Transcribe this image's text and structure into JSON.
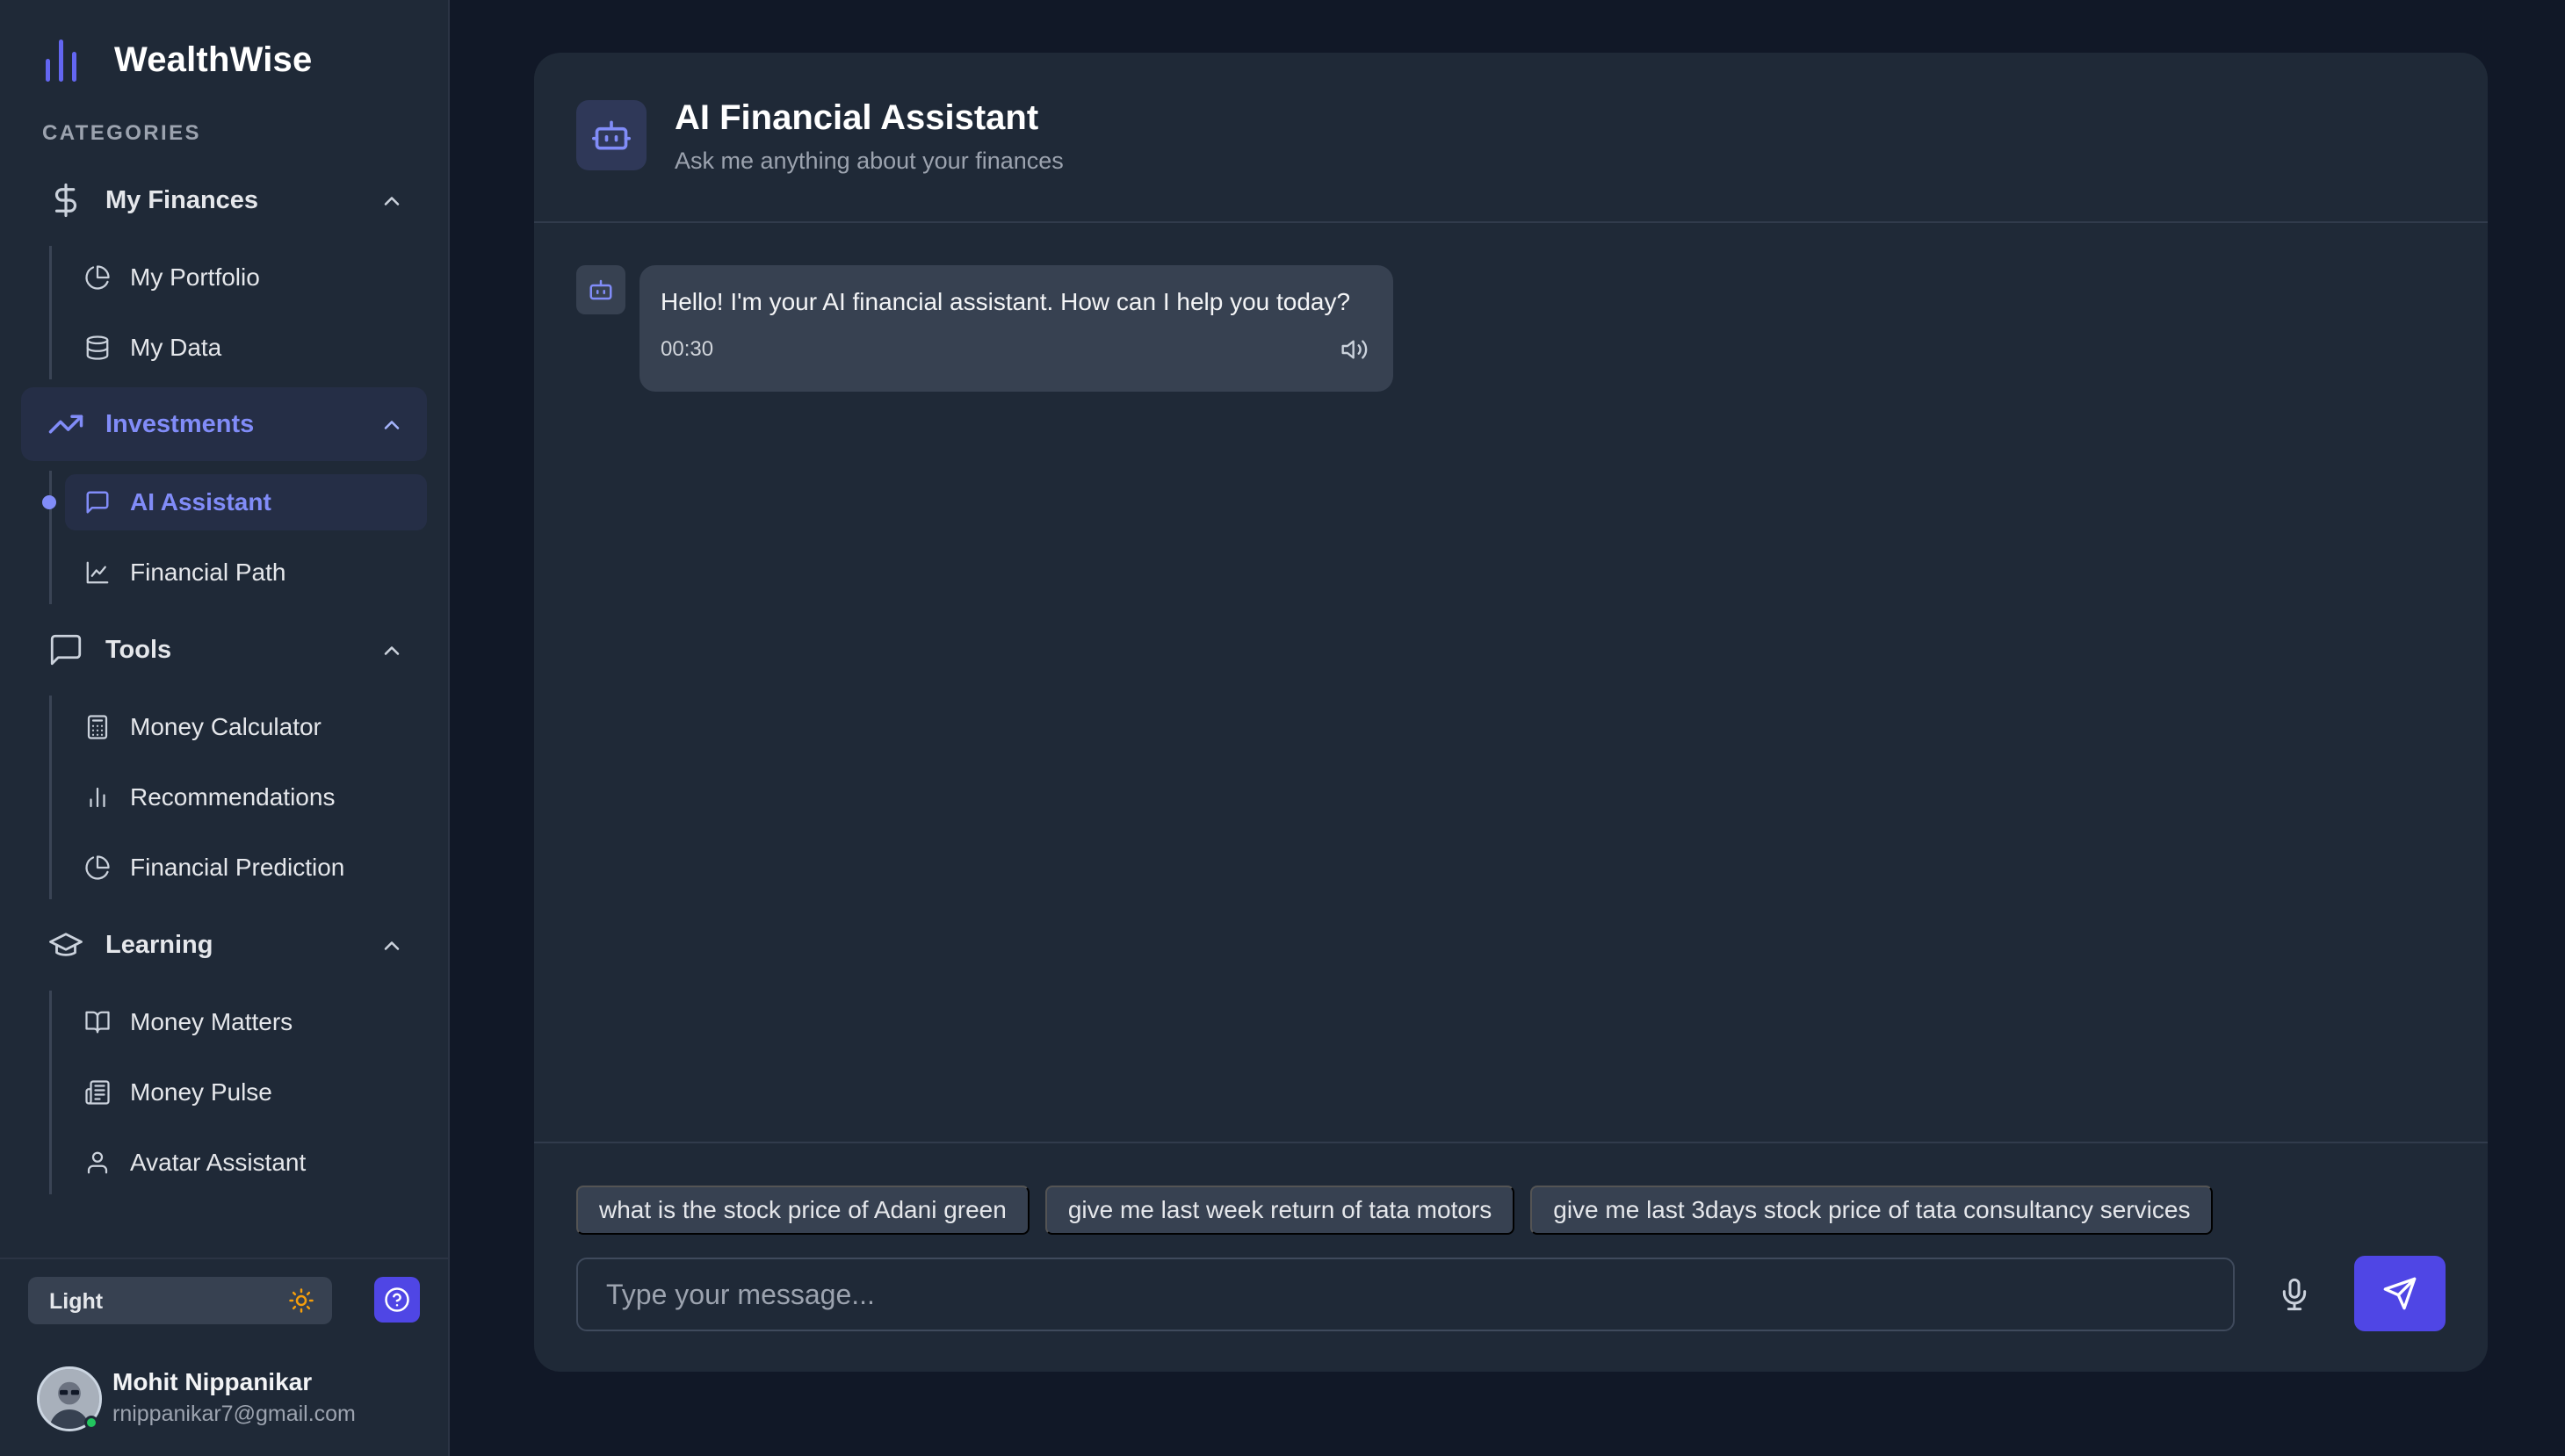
{
  "brand": {
    "name": "WealthWise"
  },
  "sidebar": {
    "categories_title": "CATEGORIES",
    "groups": [
      {
        "label": "My Finances",
        "icon": "dollar-icon",
        "expanded": true,
        "items": [
          {
            "label": "My Portfolio",
            "icon": "pie-chart-icon"
          },
          {
            "label": "My Data",
            "icon": "database-icon"
          }
        ]
      },
      {
        "label": "Investments",
        "icon": "trending-up-icon",
        "expanded": true,
        "active": true,
        "items": [
          {
            "label": "AI Assistant",
            "icon": "message-square-icon",
            "active": true
          },
          {
            "label": "Financial Path",
            "icon": "line-chart-icon"
          }
        ]
      },
      {
        "label": "Tools",
        "icon": "message-square-icon",
        "expanded": true,
        "items": [
          {
            "label": "Money Calculator",
            "icon": "calculator-icon"
          },
          {
            "label": "Recommendations",
            "icon": "bar-chart-icon"
          },
          {
            "label": "Financial Prediction",
            "icon": "pie-chart-icon"
          }
        ]
      },
      {
        "label": "Learning",
        "icon": "graduation-cap-icon",
        "expanded": true,
        "items": [
          {
            "label": "Money Matters",
            "icon": "book-open-icon"
          },
          {
            "label": "Money Pulse",
            "icon": "newspaper-icon"
          },
          {
            "label": "Avatar Assistant",
            "icon": "user-icon"
          }
        ]
      }
    ],
    "theme_toggle": {
      "label": "Light",
      "icon": "sun-icon"
    },
    "help_icon": "help-circle-icon",
    "user": {
      "name": "Mohit Nippanikar",
      "email": "rnippanikar7@gmail.com",
      "status": "online"
    }
  },
  "chat": {
    "title": "AI Financial Assistant",
    "subtitle": "Ask me anything about your finances",
    "header_icon": "bot-icon",
    "messages": [
      {
        "sender": "assistant",
        "text": "Hello! I'm your AI financial assistant. How can I help you today?",
        "time": "00:30"
      }
    ],
    "suggestions": [
      "what is the stock price of Adani green",
      "give me last week return of tata motors",
      "give me last 3days stock price of tata consultancy services"
    ],
    "input": {
      "placeholder": "Type your message...",
      "value": ""
    },
    "mic_icon": "mic-icon",
    "send_icon": "send-icon"
  },
  "colors": {
    "page_bg": "#111827",
    "panel_bg": "#1f2937",
    "accent": "#818cf8",
    "button": "#4f46e5",
    "chip_bg": "#374151",
    "online": "#22c55e",
    "sun": "#f59e0b"
  }
}
